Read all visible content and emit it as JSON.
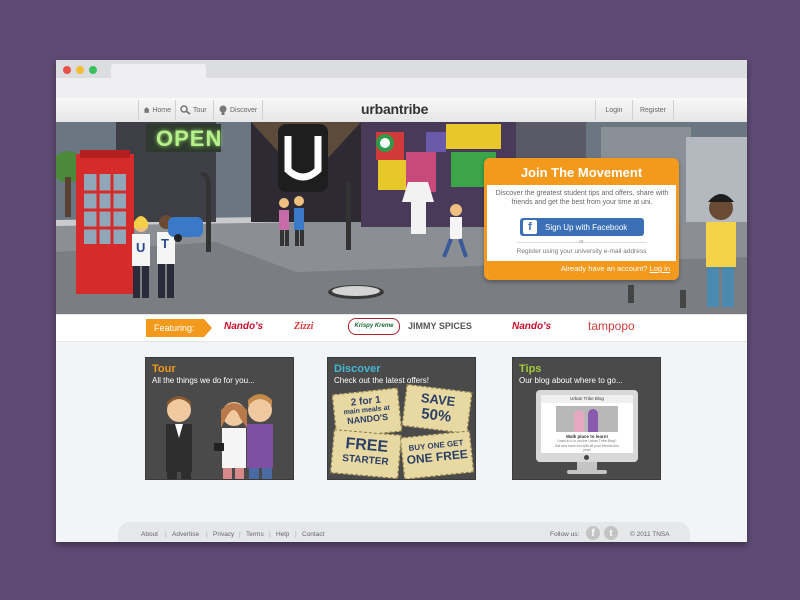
{
  "nav": {
    "home": "Home",
    "tour": "Tour",
    "discover": "Discover",
    "logo": "urbantribe",
    "login": "Login",
    "register": "Register"
  },
  "hero": {
    "sign_open": "OPEN",
    "shirt_left": "U",
    "shirt_right": "T",
    "panel_title": "Join The Movement",
    "panel_text": "Discover the greatest student tips and offers, share with friends and get the best from your time at uni.",
    "facebook_button": "Sign Up with Facebook",
    "or_text": "or",
    "email_link": "Register using your university e-mail address",
    "account_text": "Already have an account?",
    "login_link": "Log in"
  },
  "featuring": {
    "label": "Featuring:",
    "brands": [
      "Nando's",
      "Zizzi",
      "Krispy Kreme",
      "JIMMY SPICES",
      "Nando's",
      "tampopo"
    ]
  },
  "cards": [
    {
      "title": "Tour",
      "subtitle": "All the things we do for you..."
    },
    {
      "title": "Discover",
      "subtitle": "Check out the latest offers!"
    },
    {
      "title": "Tips",
      "subtitle": "Our blog about where to go..."
    }
  ],
  "coupons": {
    "c1_line1": "2 for 1",
    "c1_line2": "main meals at",
    "c1_line3": "NANDO'S",
    "c2_line1": "SAVE",
    "c2_line2": "50%",
    "c3_line1": "FREE",
    "c3_line2": "STARTER",
    "c4_line1": "BUY ONE GET",
    "c4_line2": "ONE FREE"
  },
  "blog": {
    "title": "Urban Tribe Blog",
    "heading": "Walk place to learn!",
    "body": "Used to it in uni the Urban Tribe Blog? Eat and have fun with all your friends this year!"
  },
  "footer": {
    "links": [
      "About",
      "Advertise",
      "Privacy",
      "Terms",
      "Help",
      "Contact"
    ],
    "separator": "|",
    "follow": "Follow us:",
    "copyright": "© 2011 TNSA"
  },
  "colors": {
    "background": "#5d4a74",
    "accent_orange": "#f39a1d",
    "tour_title": "#f39a1d",
    "discover_title": "#44b7d4",
    "tips_title": "#a4c93a",
    "facebook_blue": "#3b6fb6"
  }
}
